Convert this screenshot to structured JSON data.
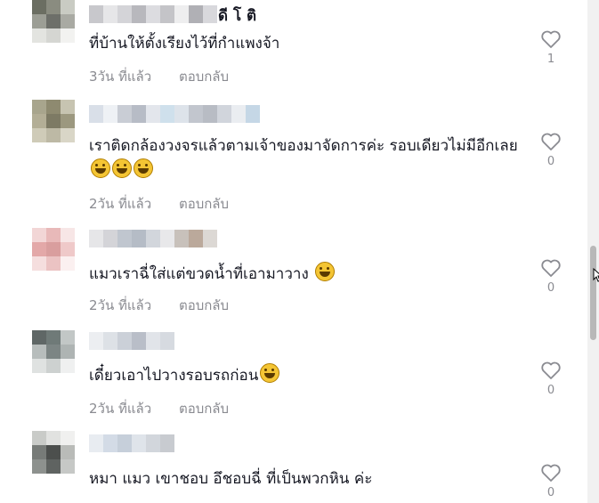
{
  "comments": [
    {
      "name_partial": "ดี โ ติ",
      "text": "ที่บ้านให้ตั้งเรียงไว้ที่กำแพงจ้า",
      "emoji": [],
      "time": "3วัน ที่แล้ว",
      "reply": "ตอบกลับ",
      "likes": "1"
    },
    {
      "text": "เราติดกล้องวงจรแล้วตามเจ้าของมาจัดการค่ะ รอบเดียวไม่มีอีกเลย",
      "emoji": [
        "laughing-emoji",
        "laughing-emoji",
        "laughing-emoji"
      ],
      "time": "2วัน ที่แล้ว",
      "reply": "ตอบกลับ",
      "likes": "0"
    },
    {
      "text": "แมวเราฉี่ใส่แต่ขวดน้ำที่เอามาวาง",
      "emoji": [
        "sweat-smile-emoji"
      ],
      "time": "2วัน ที่แล้ว",
      "reply": "ตอบกลับ",
      "likes": "0"
    },
    {
      "text": "เดี๋ยวเอาไปวางรอบรถก่อน",
      "emoji": [
        "grimacing-emoji"
      ],
      "time": "2วัน ที่แล้ว",
      "reply": "ตอบกลับ",
      "likes": "0"
    },
    {
      "text": "หมา แมว เขาชอบ อึชอบฉี่ ที่เป็นพวกหิน ค่ะ",
      "emoji": [],
      "time": "",
      "reply": "",
      "likes": "0"
    }
  ],
  "colors": {
    "text": "#161823",
    "secondary": "#8a8b91",
    "heart_outline": "#8a8b91",
    "scrollbar_thumb": "#b8b8b8"
  },
  "icons": {
    "like": "heart-outline-icon"
  }
}
